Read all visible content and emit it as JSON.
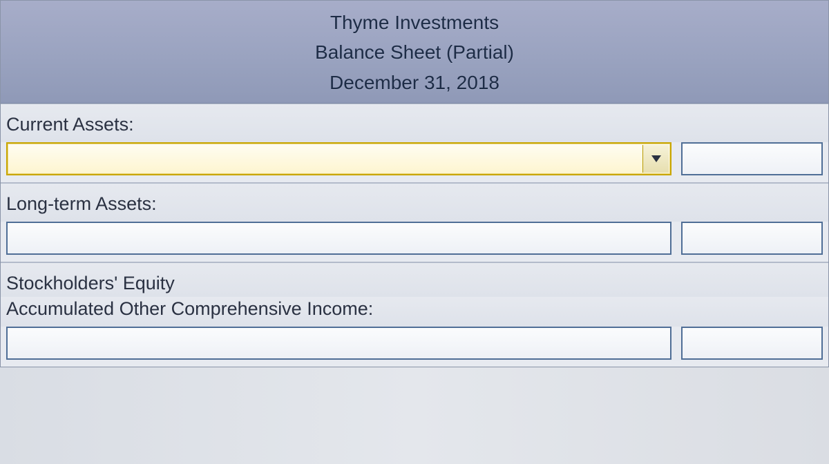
{
  "header": {
    "company": "Thyme Investments",
    "report": "Balance Sheet (Partial)",
    "date": "December 31, 2018"
  },
  "sections": {
    "current_assets": {
      "label": "Current Assets:",
      "dropdown_value": "",
      "amount": ""
    },
    "long_term_assets": {
      "label": "Long-term Assets:",
      "dropdown_value": "",
      "amount": ""
    },
    "stockholders_equity": {
      "label": "Stockholders' Equity"
    },
    "aoci": {
      "label": "Accumulated Other Comprehensive Income:",
      "dropdown_value": "",
      "amount": ""
    }
  }
}
